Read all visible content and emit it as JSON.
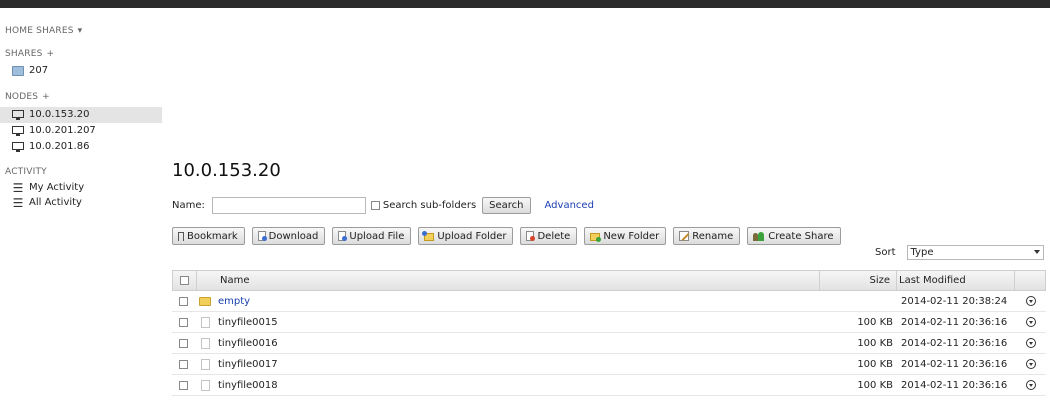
{
  "sidebar": {
    "home_shares": "HOME SHARES",
    "shares_heading": "SHARES",
    "shares": [
      {
        "label": "207"
      }
    ],
    "nodes_heading": "NODES",
    "nodes": [
      {
        "label": "10.0.153.20"
      },
      {
        "label": "10.0.201.207"
      },
      {
        "label": "10.0.201.86"
      }
    ],
    "activity_heading": "ACTIVITY",
    "activity": [
      {
        "label": "My Activity"
      },
      {
        "label": "All Activity"
      }
    ],
    "glyphs": {
      "caret": "▾",
      "plus": "+"
    }
  },
  "main": {
    "title": "10.0.153.20",
    "search": {
      "name_label": "Name:",
      "value": "",
      "subfolders_label": "Search sub-folders",
      "search_button": "Search",
      "advanced_link": "Advanced"
    },
    "toolbar": {
      "bookmark": "Bookmark",
      "download": "Download",
      "upload_file": "Upload File",
      "upload_folder": "Upload Folder",
      "delete": "Delete",
      "new_folder": "New Folder",
      "rename": "Rename",
      "create_share": "Create Share"
    },
    "sort": {
      "label": "Sort",
      "selected": "Type"
    },
    "table": {
      "columns": {
        "name": "Name",
        "size": "Size",
        "modified": "Last Modified"
      },
      "rows": [
        {
          "name": "empty",
          "size": "",
          "modified": "2014-02-11 20:38:24",
          "type": "folder"
        },
        {
          "name": "tinyfile0015",
          "size": "100 KB",
          "modified": "2014-02-11 20:36:16",
          "type": "file"
        },
        {
          "name": "tinyfile0016",
          "size": "100 KB",
          "modified": "2014-02-11 20:36:16",
          "type": "file"
        },
        {
          "name": "tinyfile0017",
          "size": "100 KB",
          "modified": "2014-02-11 20:36:16",
          "type": "file"
        },
        {
          "name": "tinyfile0018",
          "size": "100 KB",
          "modified": "2014-02-11 20:36:16",
          "type": "file"
        }
      ]
    }
  }
}
